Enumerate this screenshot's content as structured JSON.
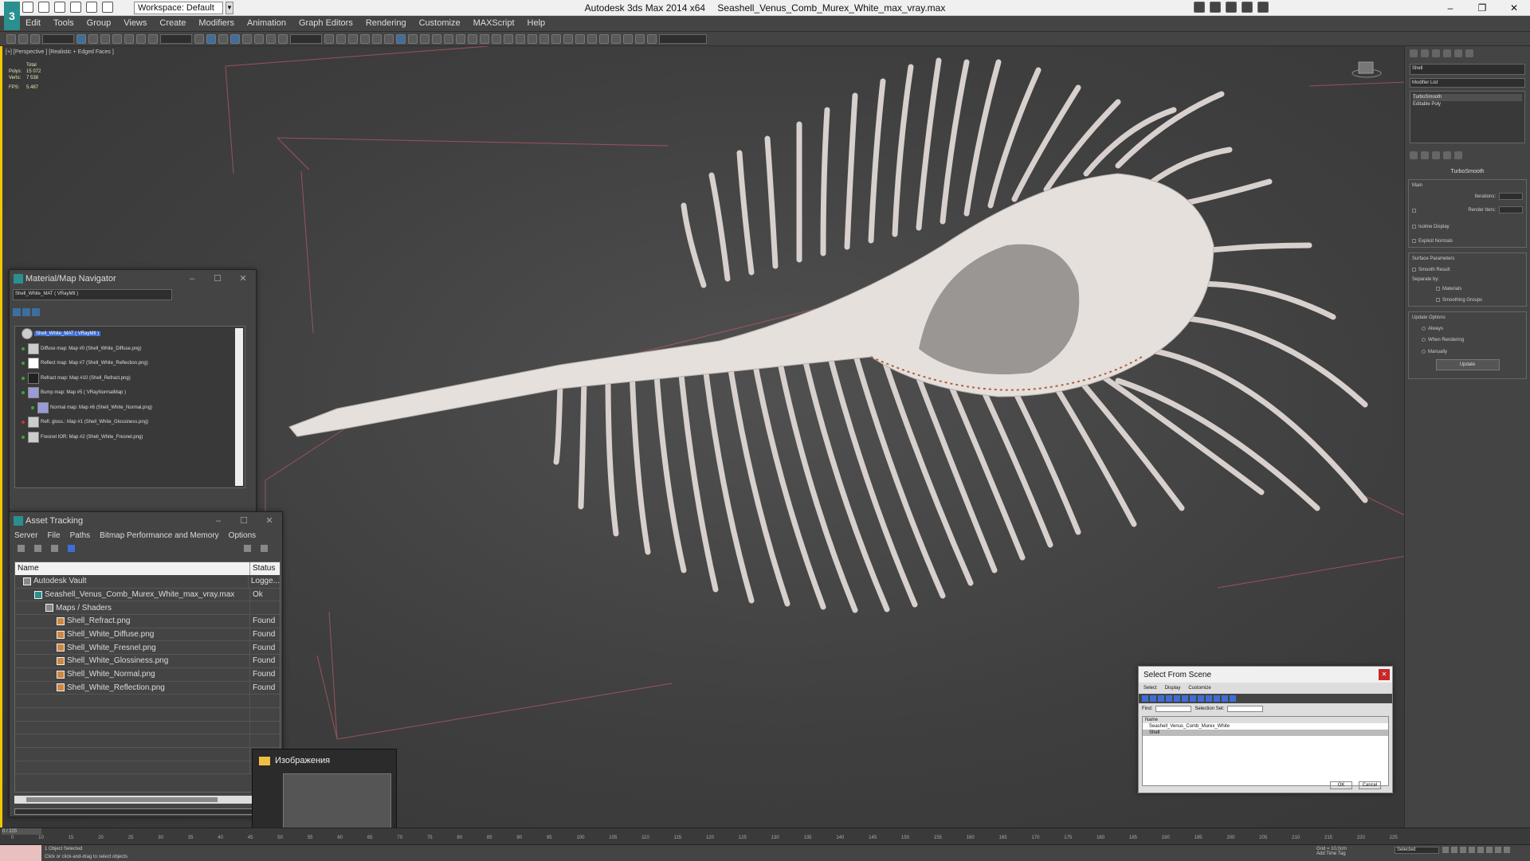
{
  "window": {
    "workspace_label": "Workspace: Default",
    "app_title": "Autodesk 3ds Max  2014 x64",
    "file_title": "Seashell_Venus_Comb_Murex_White_max_vray.max"
  },
  "menu": [
    "Edit",
    "Tools",
    "Group",
    "Views",
    "Create",
    "Modifiers",
    "Animation",
    "Graph Editors",
    "Rendering",
    "Customize",
    "MAXScript",
    "Help"
  ],
  "viewport": {
    "label": "[+] [Perspective ] [Realistic + Edged Faces ]",
    "stats": {
      "total_label": "Total",
      "polys_label": "Polys:",
      "polys": "15 072",
      "verts_label": "Verts:",
      "verts": "7 538",
      "fps_label": "FPS:",
      "fps": "5.487"
    }
  },
  "command_panel": {
    "object_name": "Shell",
    "modifier_list": "Modifier List",
    "stack": [
      "TurboSmooth",
      "Editable Poly"
    ],
    "turbosmooth_title": "TurboSmooth",
    "main": "Main",
    "iterations": "Iterations:",
    "render_iters": "Render Iters:",
    "isoline": "Isoline Display",
    "explicit": "Explicit Normals",
    "surface": "Surface Parameters",
    "smooth_result": "Smooth Result",
    "separate_by": "Separate by:",
    "materials": "Materials",
    "smoothing_groups": "Smoothing Groups",
    "update_options": "Update Options",
    "always": "Always",
    "when_rendering": "When Rendering",
    "manually": "Manually",
    "update_btn": "Update"
  },
  "material_navigator": {
    "title": "Material/Map Navigator",
    "field": "Shell_White_MAT  ( VRayMtl )",
    "root": "Shell_White_MAT  ( VRayMtl )",
    "items": [
      "Diffuse map: Map #0 (Shell_White_Diffuse.png)",
      "Reflect map: Map #7 (Shell_White_Reflection.png)",
      "Refract map: Map #10 (Shell_Refract.png)",
      "Bump map: Map #5  ( VRayNormalMap )",
      "Normal map: Map #6 (Shell_White_Normal.png)",
      "Refl. gloss.: Map #1 (Shell_White_Glossiness.png)",
      "Fresnel IOR: Map #2 (Shell_White_Fresnel.png)"
    ]
  },
  "asset_tracking": {
    "title": "Asset Tracking",
    "menu": [
      "Server",
      "File",
      "Paths",
      "Bitmap Performance and Memory",
      "Options"
    ],
    "col_name": "Name",
    "col_status": "Status",
    "rows": [
      {
        "name": "Autodesk Vault",
        "status": "Logge..."
      },
      {
        "name": "Seashell_Venus_Comb_Murex_White_max_vray.max",
        "status": "Ok"
      },
      {
        "name": "Maps / Shaders",
        "status": ""
      },
      {
        "name": "Shell_Refract.png",
        "status": "Found"
      },
      {
        "name": "Shell_White_Diffuse.png",
        "status": "Found"
      },
      {
        "name": "Shell_White_Fresnel.png",
        "status": "Found"
      },
      {
        "name": "Shell_White_Glossiness.png",
        "status": "Found"
      },
      {
        "name": "Shell_White_Normal.png",
        "status": "Found"
      },
      {
        "name": "Shell_White_Reflection.png",
        "status": "Found"
      }
    ]
  },
  "select_from_scene": {
    "title": "Select From Scene",
    "menu": [
      "Select",
      "Display",
      "Customize"
    ],
    "find": "Find:",
    "selection_set": "Selection Set:",
    "col_name": "Name",
    "items": [
      "Seashell_Venus_Comb_Murex_White",
      "Shell"
    ],
    "ok": "OK",
    "cancel": "Cancel"
  },
  "taskbar_thumb": {
    "title": "Изображения"
  },
  "timeline": {
    "frame": "0 / 225",
    "ticks": [
      "0",
      "10",
      "15",
      "20",
      "25",
      "30",
      "35",
      "40",
      "45",
      "50",
      "55",
      "60",
      "65",
      "70",
      "75",
      "80",
      "85",
      "90",
      "95",
      "100",
      "105",
      "110",
      "115",
      "120",
      "125",
      "130",
      "135",
      "140",
      "145",
      "150",
      "155",
      "160",
      "165",
      "170",
      "175",
      "180",
      "185",
      "190",
      "195",
      "200",
      "205",
      "210",
      "215",
      "220",
      "225"
    ]
  },
  "status": {
    "selected": "1 Object Selected",
    "hint": "Click or click-and-drag to select objects",
    "grid": "Grid = 10,0cm",
    "add_time_tag": "Add Time Tag",
    "sel_mode": "Selected"
  }
}
